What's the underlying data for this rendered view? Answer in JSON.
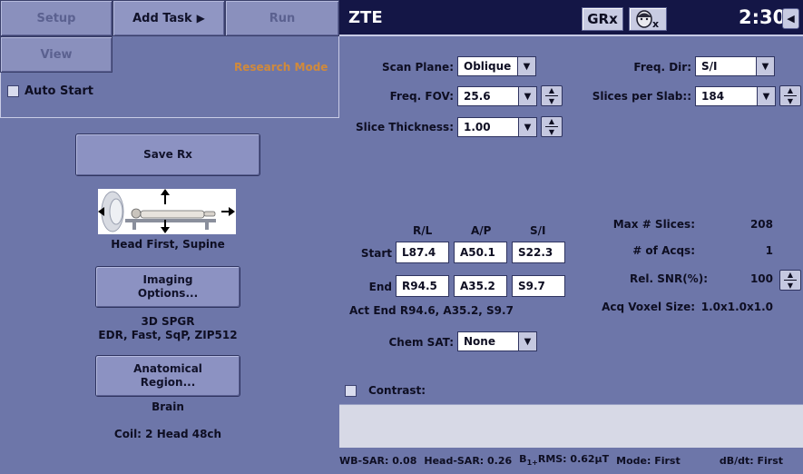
{
  "tabs": {
    "setup": "Setup",
    "add_task": "Add Task",
    "run": "Run",
    "view": "View"
  },
  "mode_label": "Research Mode",
  "auto_start_label": "Auto Start",
  "left": {
    "save_rx": "Save Rx",
    "patient_position": "Head First, Supine",
    "imaging_options": "Imaging\nOptions...",
    "sequence": "3D SPGR",
    "sequence_options": "EDR, Fast, SqP, ZIP512",
    "anatomical_region": "Anatomical\nRegion...",
    "region_value": "Brain",
    "coil": "Coil: 2 Head 48ch"
  },
  "header": {
    "title": "ZTE",
    "grx_label": "GRx",
    "time": "2:30"
  },
  "params": {
    "scan_plane_label": "Scan Plane:",
    "scan_plane_value": "Oblique",
    "freq_fov_label": "Freq. FOV:",
    "freq_fov_value": "25.6",
    "slice_thickness_label": "Slice Thickness:",
    "slice_thickness_value": "1.00",
    "freq_dir_label": "Freq. Dir:",
    "freq_dir_value": "S/I",
    "slices_per_slab_label": "Slices per Slab::",
    "slices_per_slab_value": "184"
  },
  "coords": {
    "col_rl": "R/L",
    "col_ap": "A/P",
    "col_si": "S/I",
    "start_label": "Start",
    "end_label": "End",
    "start": [
      "L87.4",
      "A50.1",
      "S22.3"
    ],
    "end": [
      "R94.5",
      "A35.2",
      "S9.7"
    ],
    "act_end": "Act End R94.6, A35.2, S9.7"
  },
  "info": {
    "max_slices_label": "Max # Slices:",
    "max_slices_value": "208",
    "num_acqs_label": "# of Acqs:",
    "num_acqs_value": "1",
    "rel_snr_label": "Rel. SNR(%):",
    "rel_snr_value": "100",
    "voxel_label": "Acq Voxel Size:",
    "voxel_value": "1.0x1.0x1.0"
  },
  "chem_sat_label": "Chem SAT:",
  "chem_sat_value": "None",
  "contrast_label": "Contrast:",
  "footer": {
    "wb_sar": "WB-SAR: 0.08",
    "head_sar": "Head-SAR: 0.26",
    "b1rms_prefix": "B",
    "b1rms_sub": "1+",
    "b1rms_value": "RMS: 0.62µT",
    "mode": "Mode: First",
    "dbdt": "dB/dt: First"
  }
}
